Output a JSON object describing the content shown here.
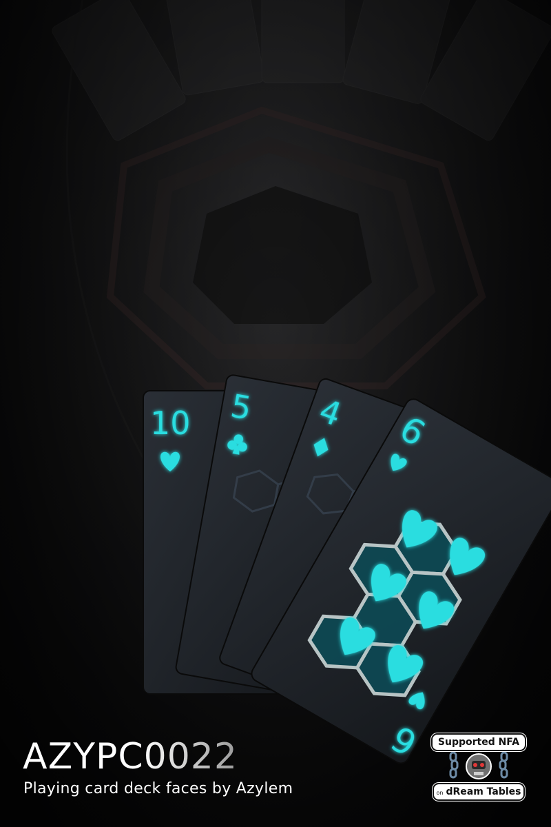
{
  "title": "AZYPC0022",
  "subtitle": "Playing card deck faces by Azylem",
  "badge": {
    "top_label": "Supported NFA",
    "bottom_prefix": "on",
    "bottom_label": "dReam Tables"
  },
  "cards": [
    {
      "rank": "10",
      "suit": "heart-icon"
    },
    {
      "rank": "5",
      "suit": "club-icon"
    },
    {
      "rank": "4",
      "suit": "diamond-icon"
    },
    {
      "rank": "6",
      "suit": "heart-icon",
      "rank_bottom": "9"
    }
  ],
  "colors": {
    "accent": "#29dde0",
    "card": "#1c2026",
    "background": "#141415"
  }
}
